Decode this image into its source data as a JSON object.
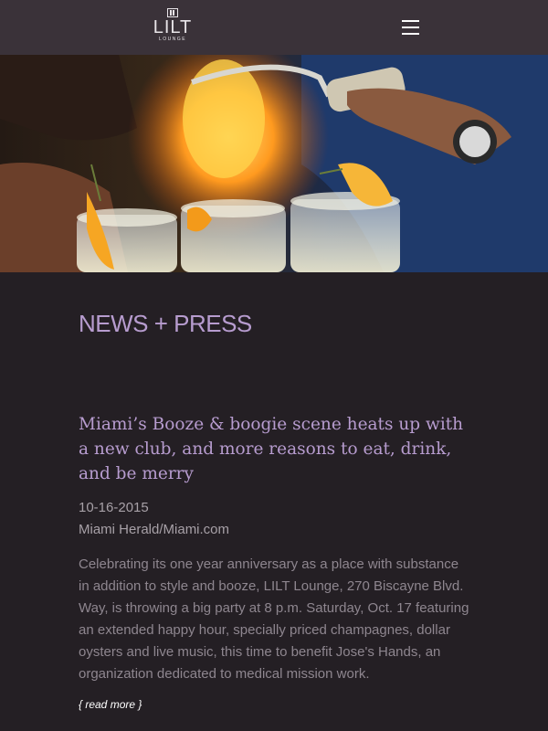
{
  "header": {
    "logo_text": "LILT",
    "logo_subtext": "LOUNGE",
    "menu_icon": "hamburger-menu-icon"
  },
  "hero": {
    "image": "bartender torching cocktails with citrus garnish"
  },
  "page": {
    "section_title": "NEWS + PRESS"
  },
  "article": {
    "title": "Miami’s Booze & boogie scene heats up with a new club, and more reasons to eat, drink, and be merry",
    "date": "10-16-2015",
    "source": "Miami Herald/Miami.com",
    "body": "Celebrating its one year anniversary as a place with substance in addition to style and booze, LILT Lounge, 270 Biscayne Blvd. Way, is throwing a big party at 8 p.m. Saturday, Oct. 17 featuring an extended happy hour, specially priced champagnes, dollar oysters and live music, this time to benefit Jose's Hands, an organization dedicated to medical mission work.",
    "read_more_label": "{ read more }"
  },
  "colors": {
    "header_bg": "#3a3239",
    "page_bg": "#241f24",
    "accent": "#b79ccf",
    "body_text": "#8e868f"
  }
}
